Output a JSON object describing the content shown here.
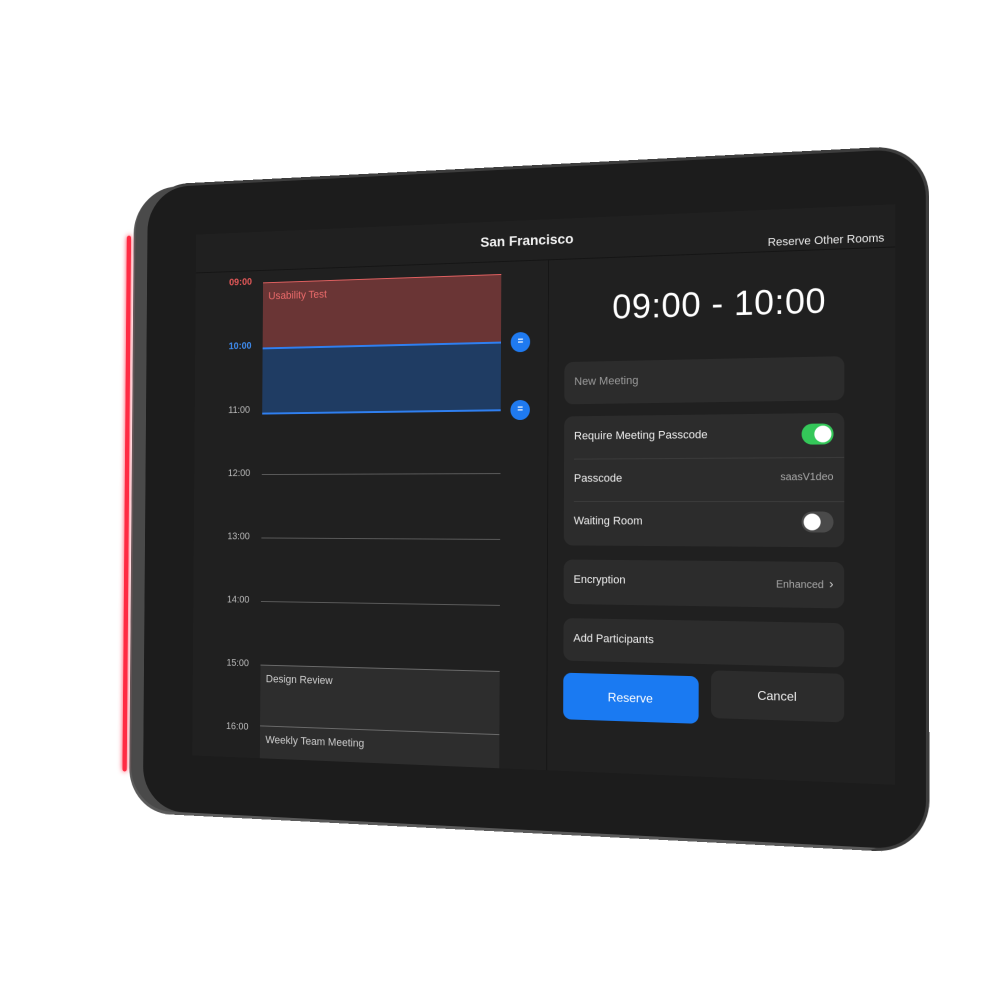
{
  "header": {
    "room_title": "San Francisco",
    "reserve_other_rooms": "Reserve Other Rooms"
  },
  "schedule": {
    "hours": [
      "09:00",
      "10:00",
      "11:00",
      "12:00",
      "13:00",
      "14:00",
      "15:00",
      "16:00"
    ],
    "events": [
      {
        "title": "Usability Test",
        "status": "busy"
      },
      {
        "title": "Design Review",
        "status": "booked"
      },
      {
        "title": "Weekly Team Meeting",
        "status": "booked"
      }
    ],
    "selection": {
      "start": "10:00",
      "end": "11:00"
    },
    "handle_glyph": "="
  },
  "booking": {
    "time_range": "09:00 - 10:00",
    "meeting_name_placeholder": "New Meeting",
    "require_passcode_label": "Require Meeting Passcode",
    "require_passcode_on": true,
    "passcode_label": "Passcode",
    "passcode_value": "saasV1deo",
    "waiting_room_label": "Waiting Room",
    "waiting_room_on": false,
    "encryption_label": "Encryption",
    "encryption_value": "Enhanced",
    "chevron_glyph": "›",
    "add_participants_label": "Add Participants",
    "reserve_label": "Reserve",
    "cancel_label": "Cancel"
  },
  "colors": {
    "accent_blue": "#1a7af2",
    "busy_red": "#e45858",
    "toggle_green": "#34c759",
    "status_led": "#ff2b43"
  }
}
